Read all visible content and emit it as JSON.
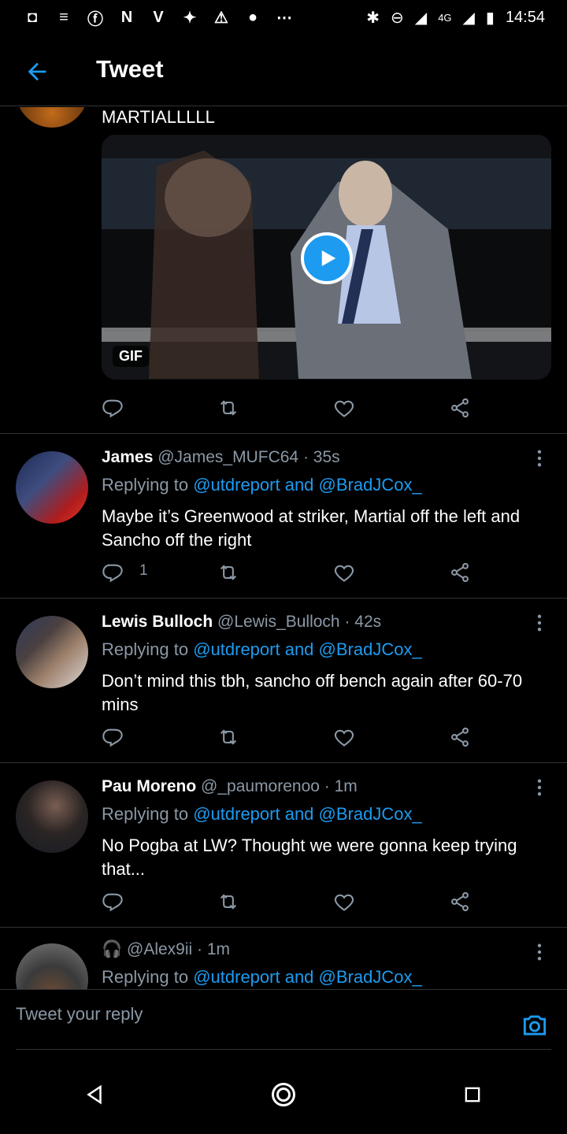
{
  "status": {
    "time": "14:54",
    "network": "4G"
  },
  "header": {
    "title": "Tweet"
  },
  "top_tweet": {
    "text": "MARTIALLLLL",
    "gif_label": "GIF"
  },
  "replies": [
    {
      "name": "James",
      "handle": "@James_MUFC64",
      "time": "· 35s",
      "replying_prefix": "Replying to",
      "replying_targets": "@utdreport and @BradJCox_",
      "text": "Maybe it’s Greenwood at striker, Martial off the left and Sancho off the right",
      "reply_count": "1"
    },
    {
      "name": "Lewis Bulloch",
      "handle": "@Lewis_Bulloch",
      "time": "· 42s",
      "replying_prefix": "Replying to",
      "replying_targets": "@utdreport and @BradJCox_",
      "text": "Don’t mind this tbh, sancho off bench again after 60-70 mins",
      "reply_count": ""
    },
    {
      "name": "Pau Moreno",
      "handle": "@_paumorenoo",
      "time": "· 1m",
      "replying_prefix": "Replying to",
      "replying_targets": "@utdreport and @BradJCox_",
      "text": "No Pogba at LW? Thought we were gonna keep trying that...",
      "reply_count": ""
    },
    {
      "name": "🎧",
      "handle": "@Alex9ii",
      "time": "· 1m",
      "replying_prefix": "Replying to",
      "replying_targets": "@utdreport and @BradJCox_",
      "text": "",
      "reply_count": ""
    }
  ],
  "composer": {
    "placeholder": "Tweet your reply"
  },
  "colors": {
    "accent": "#1d9bf0",
    "muted": "#8b98a5",
    "divider": "#2f3336"
  }
}
